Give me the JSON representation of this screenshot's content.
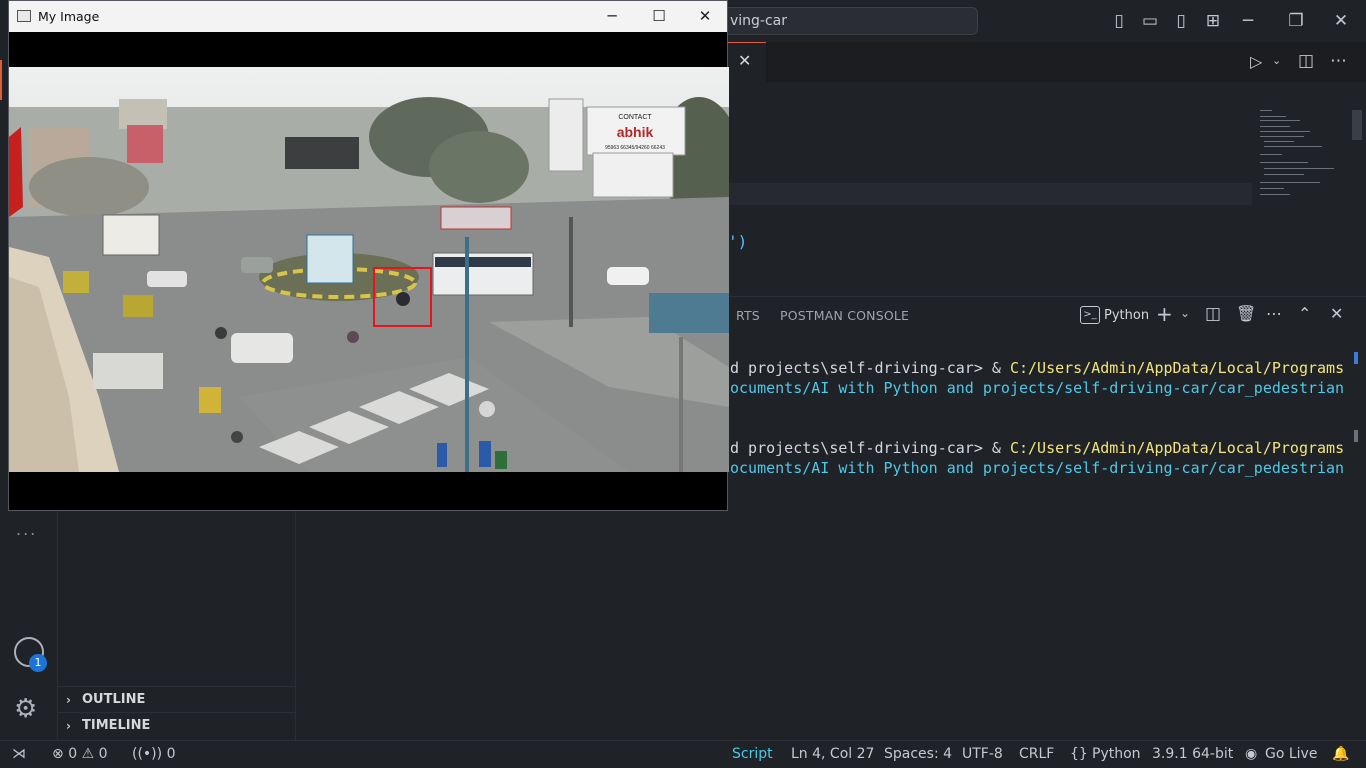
{
  "titlebar": {
    "search_text": "ving-car",
    "icons": [
      "toggle-primary-sidebar-icon",
      "toggle-panel-icon",
      "toggle-secondary-sidebar-icon",
      "customize-layout-icon",
      "minimize-icon",
      "restore-icon",
      "close-icon"
    ]
  },
  "editor": {
    "tab_close": "✕",
    "code_fragment": "')"
  },
  "panel": {
    "tabs": [
      "RTS",
      "POSTMAN CONSOLE"
    ],
    "terminal_kind": "Python",
    "terminal_lines": [
      {
        "a": "d projects\\self-driving-car> & ",
        "b": "C:/Users/Admin/AppData/Local/Programs"
      },
      {
        "c": "ocuments/AI with Python and projects/self-driving-car/car_pedestrian"
      },
      {
        "a": "d projects\\self-driving-car> & ",
        "b": "C:/Users/Admin/AppData/Local/Programs"
      },
      {
        "c": "ocuments/AI with Python and projects/self-driving-car/car_pedestrian"
      }
    ]
  },
  "sidebar": {
    "outline": "OUTLINE",
    "timeline": "TIMELINE",
    "more": "..."
  },
  "accounts_badge": "1",
  "statusbar": {
    "errors": "0",
    "warnings": "0",
    "ports": "0",
    "script": "Script",
    "position": "Ln 4, Col 27",
    "spaces": "Spaces: 4",
    "encoding": "UTF-8",
    "eol": "CRLF",
    "language": "Python",
    "interpreter": "3.9.1 64-bit",
    "golive": "Go Live"
  },
  "image_window": {
    "title": "My Image",
    "detection_color": "#e8141c",
    "billboard_top": "CONTACT",
    "billboard_brand": "abhik",
    "billboard_phone": "95963 66345/94260 66243"
  }
}
